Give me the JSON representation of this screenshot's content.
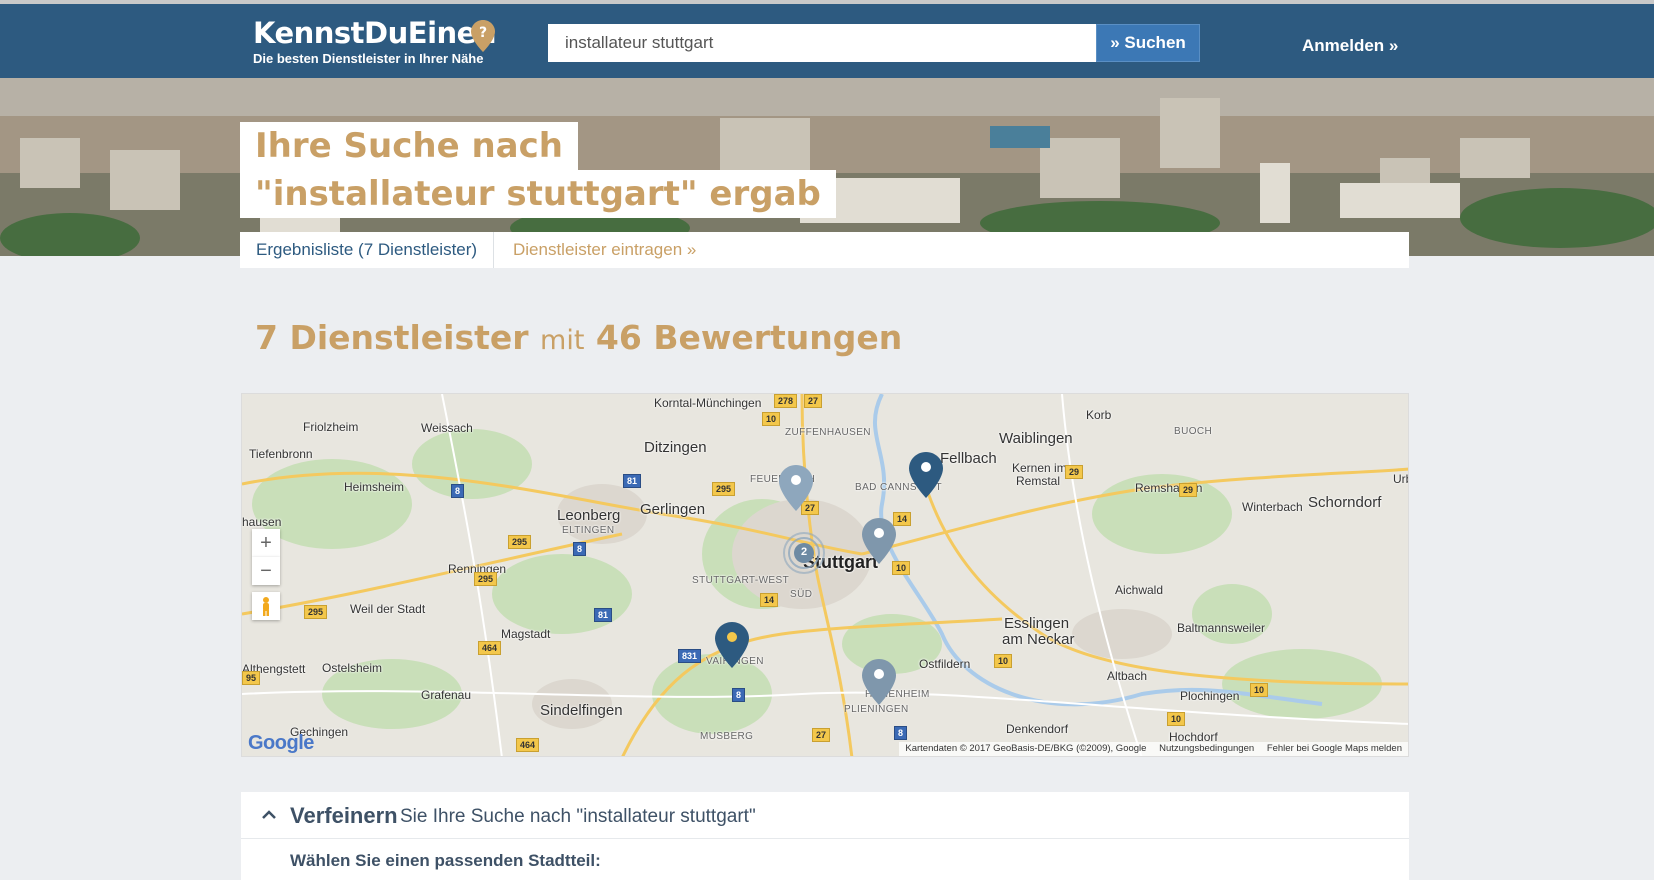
{
  "header": {
    "logo_text": "KennstDuEinen",
    "tagline": "Die besten Dienstleister in Ihrer Nähe",
    "search_value": "installateur stuttgart",
    "search_button": "» Suchen",
    "login": "Anmelden »"
  },
  "hero": {
    "line1": "Ihre Suche nach",
    "line2": "\"installateur stuttgart\" ergab"
  },
  "tabs": {
    "results": "Ergebnisliste (7 Dienstleister)",
    "add": "Dienstleister eintragen »"
  },
  "results": {
    "count": "7 Dienstleister",
    "connector": "mit",
    "reviews": "46 Bewertungen"
  },
  "map": {
    "places": {
      "korntal": "Korntal-Münchingen",
      "friolzheim": "Friolzheim",
      "weissach": "Weissach",
      "korb": "Korb",
      "waiblingen": "Waiblingen",
      "buoch": "BUOCH",
      "zuffenhausen": "ZUFFENHAUSEN",
      "tiefenbronn": "Tiefenbronn",
      "ditzingen": "Ditzingen",
      "fellbach": "Fellbach",
      "kernen": "Kernen im",
      "remstal": "Remstal",
      "heimsheim": "Heimsheim",
      "feuerbach": "FEUERBACH",
      "bad_cannstatt": "BAD CANNSTATT",
      "remshalden": "Remshalden",
      "winterbach": "Winterbach",
      "schorndorf": "Schorndorf",
      "urb": "Urb",
      "hausen": "hausen",
      "leonberg": "Leonberg",
      "eltingen": "ELTINGEN",
      "gerlingen": "Gerlingen",
      "stuttgart": "Stuttgart",
      "renningen": "Renningen",
      "stuttgart_west": "STUTTGART-WEST",
      "aichwald": "Aichwald",
      "sued": "SÜD",
      "weil_der_stadt": "Weil der Stadt",
      "esslingen": "Esslingen",
      "am_neckar": "am Neckar",
      "baltmannsweiler": "Baltmannsweiler",
      "magstadt": "Magstadt",
      "althengstett": "Althengstett",
      "ostelsheim": "Ostelsheim",
      "vaihingen": "VAIHINGEN",
      "ostfildern": "Ostfildern",
      "altbach": "Altbach",
      "grafenau": "Grafenau",
      "hohenheim": "HOHENHEIM",
      "plochingen": "Plochingen",
      "sindelfingen": "Sindelfingen",
      "plieningen": "PLIENINGEN",
      "denkendorf": "Denkendorf",
      "hochdorf": "Hochdorf",
      "gechingen": "Gechingen",
      "musberg": "MUSBERG"
    },
    "roads": [
      "27",
      "10",
      "8",
      "81",
      "295",
      "29",
      "14",
      "464",
      "831",
      "95",
      "278"
    ],
    "cluster_count": "2",
    "zoom_in": "+",
    "zoom_out": "−",
    "attribution": "Kartendaten © 2017 GeoBasis-DE/BKG (©2009), Google",
    "terms": "Nutzungsbedingungen",
    "report": "Fehler bei Google Maps melden",
    "google": "Google",
    "colors": {
      "pin_dark": "#2d5a80",
      "pin_light": "#6d8aa3",
      "pin_selected_dot": "#f3c74b"
    }
  },
  "refine": {
    "strong": "Verfeinern",
    "sub": "Sie Ihre Suche nach \"installateur stuttgart\"",
    "district_label": "Wählen Sie einen passenden Stadtteil:"
  },
  "colors": {
    "header_bg": "#2d5a80",
    "accent_gold": "#c9a066",
    "button_blue": "#3c78b5",
    "page_bg": "#eceef1"
  }
}
